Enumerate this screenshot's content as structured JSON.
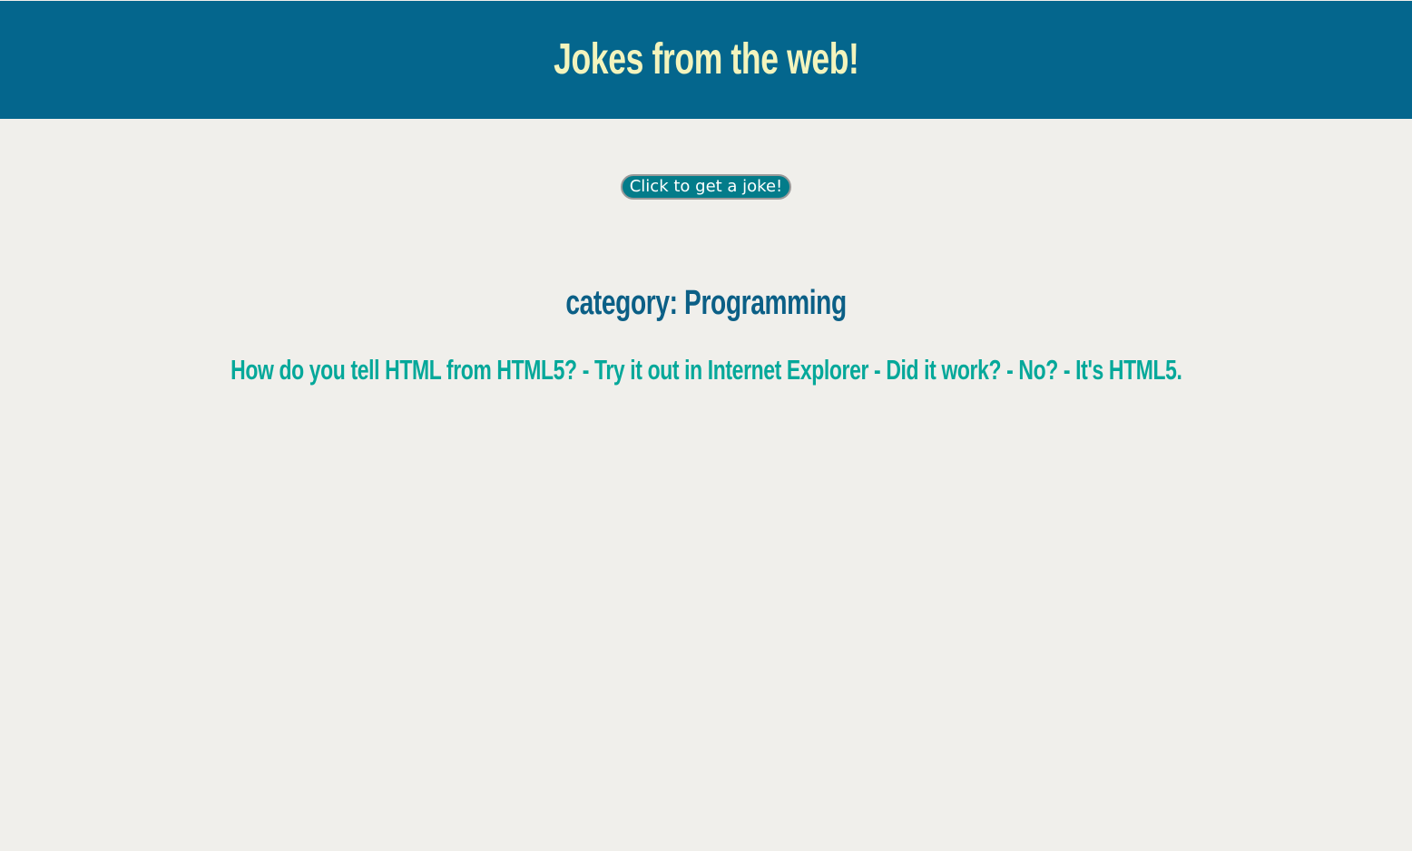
{
  "header": {
    "title": "Jokes from the web!"
  },
  "button": {
    "label": "Click to get a joke!"
  },
  "joke": {
    "category": "category: Programming",
    "text": "How do you tell HTML from HTML5? - Try it out in Internet Explorer - Did it work? - No? - It's HTML5."
  },
  "colors": {
    "header_bg": "#04668d",
    "title": "#f3f4bd",
    "button_bg": "#037c8a",
    "category": "#0b5f86",
    "joke": "#05a89a",
    "page_bg": "#f0efeb"
  }
}
